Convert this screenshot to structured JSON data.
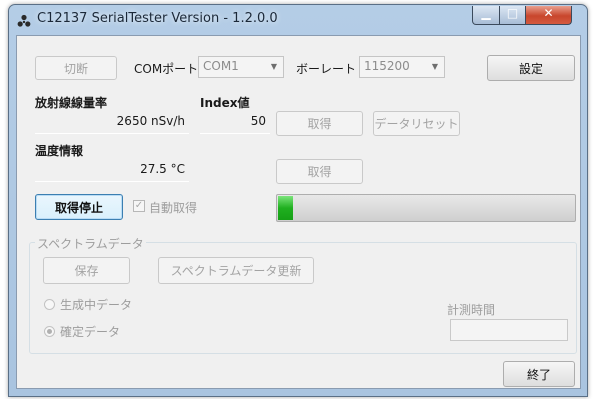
{
  "window": {
    "title": "C12137 SerialTester Version - 1.2.0.0",
    "controls": {
      "minimize": "▁",
      "maximize": "□",
      "close": "✕"
    }
  },
  "connection": {
    "disconnect_label": "切断",
    "com_port_label": "COMポート",
    "com_port_value": "COM1",
    "baud_rate_label": "ボーレート",
    "baud_rate_value": "115200",
    "settings_label": "設定"
  },
  "dose": {
    "label": "放射線線量率",
    "value": "2650 nSv/h",
    "index_label": "Index値",
    "index_value": "50",
    "acquire_label": "取得",
    "data_reset_label": "データリセット"
  },
  "temperature": {
    "label": "温度情報",
    "value": "27.5 °C",
    "acquire_label": "取得"
  },
  "acquisition": {
    "stop_label": "取得停止",
    "auto_acquire_label": "自動取得",
    "auto_acquire_checked": true,
    "progress_fraction": 0.05
  },
  "spectrum": {
    "group_label": "スペクトラムデータ",
    "save_label": "保存",
    "update_label": "スペクトラムデータ更新",
    "generating_label": "生成中データ",
    "confirmed_label": "確定データ",
    "selected": "confirmed",
    "measure_time_label": "計測時間",
    "measure_time_value": ""
  },
  "footer": {
    "exit_label": "終了"
  },
  "colors": {
    "progress_fill": "#20b020",
    "title_bar": "#b4cde6",
    "close_button": "#c8462d"
  }
}
